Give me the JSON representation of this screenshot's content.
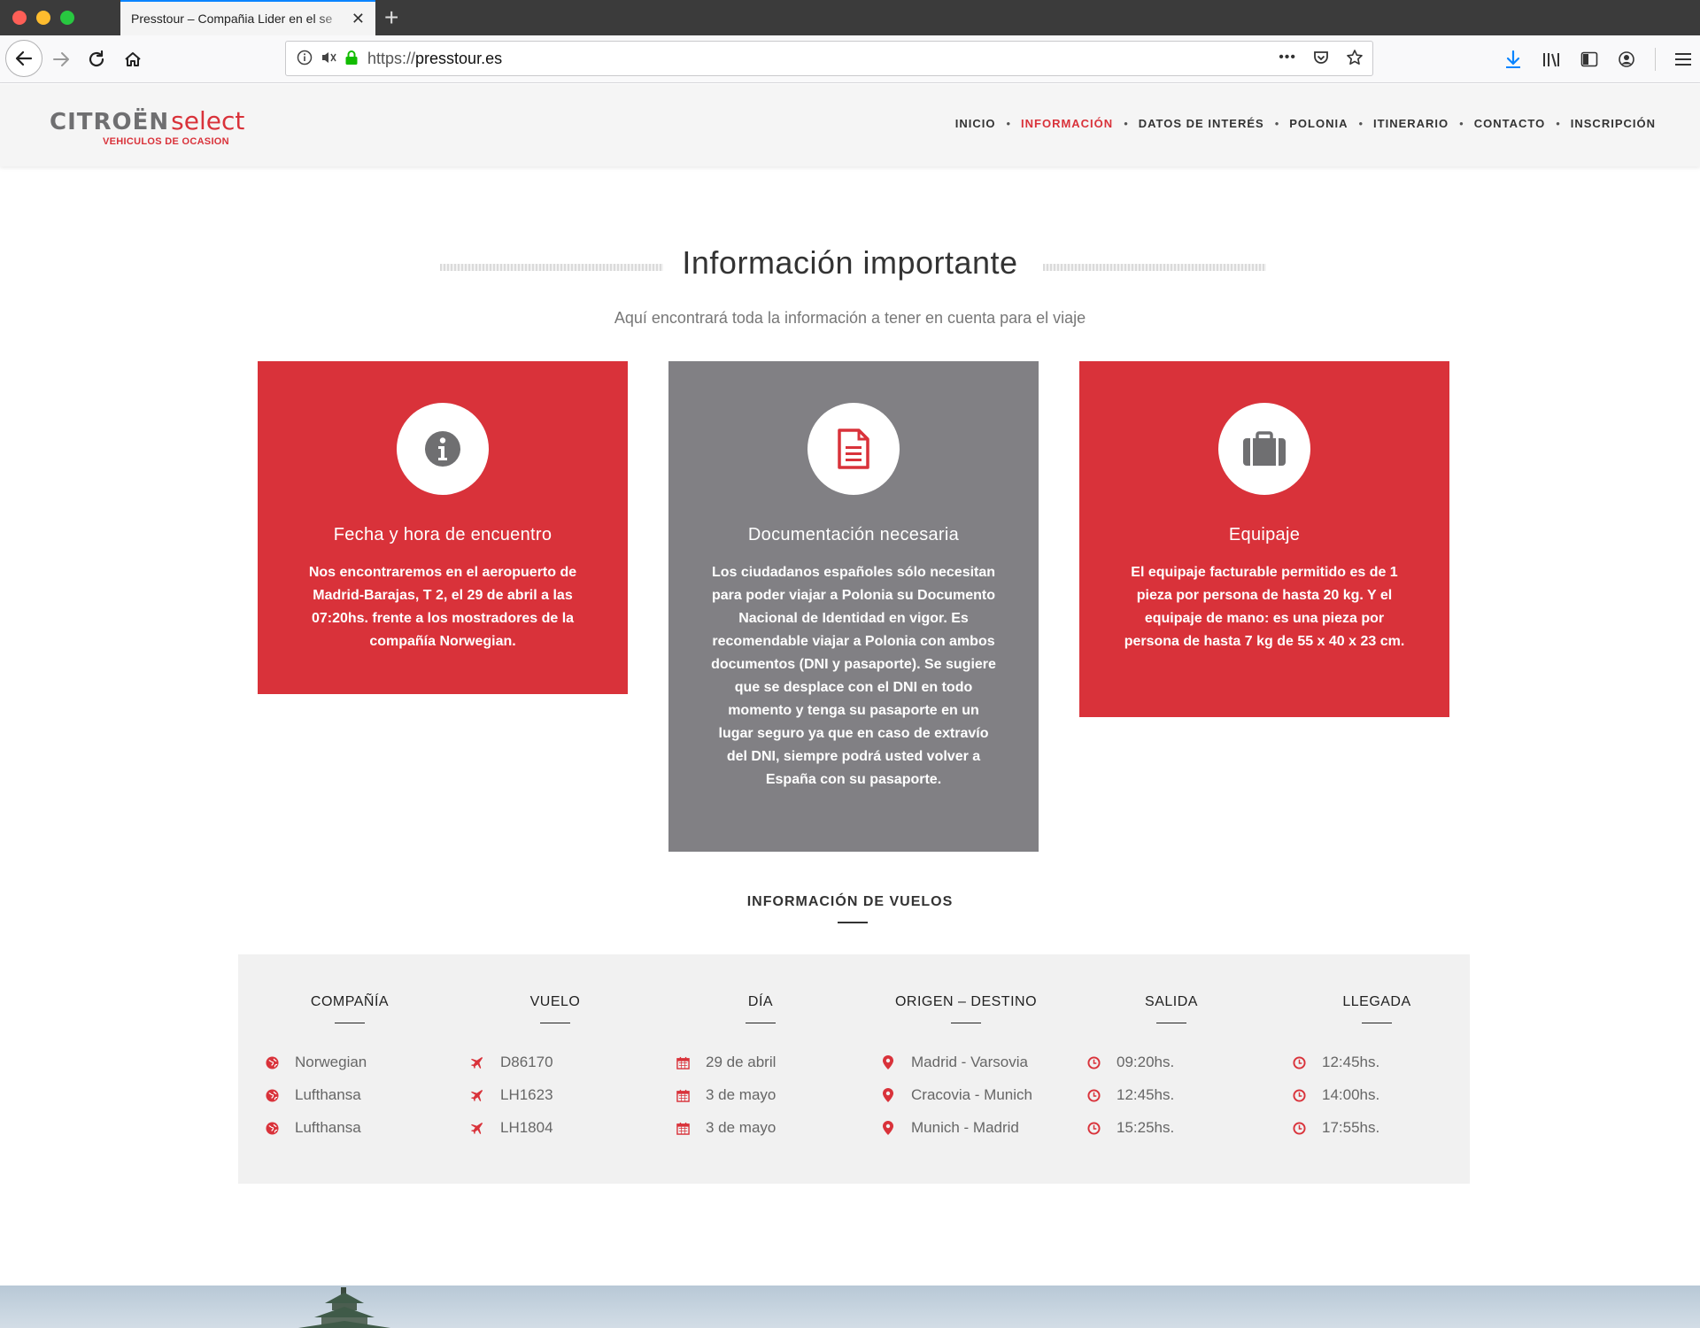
{
  "browser": {
    "tab_title": "Presstour – Compañia Lider en el se",
    "url_scheme": "https://",
    "url_host": "presstour.es",
    "overflow_label": "•••"
  },
  "site": {
    "logo_brand": "CITROËN",
    "logo_select": "select",
    "logo_sub": "VEHICULOS DE OCASION",
    "menu": [
      {
        "label": "INICIO",
        "active": false
      },
      {
        "label": "INFORMACIÓN",
        "active": true
      },
      {
        "label": "DATOS DE INTERÉS",
        "active": false
      },
      {
        "label": "POLONIA",
        "active": false
      },
      {
        "label": "ITINERARIO",
        "active": false
      },
      {
        "label": "CONTACTO",
        "active": false
      },
      {
        "label": "INSCRIPCIÓN",
        "active": false
      }
    ],
    "menu_separator": "•"
  },
  "info": {
    "title": "Información importante",
    "subtitle": "Aquí encontrará toda la información a tener en cuenta para el viaje",
    "cards": [
      {
        "icon": "info-icon",
        "title": "Fecha y hora de encuentro",
        "text": "Nos encontraremos en el aeropuerto de Madrid-Barajas, T 2, el 29 de abril a las 07:20hs. frente a los mostradores de la compañía Norwegian."
      },
      {
        "icon": "document-icon",
        "title": "Documentación necesaria",
        "text": "Los ciudadanos españoles sólo necesitan para poder viajar a Polonia su Documento Nacional de Identidad en vigor. Es recomendable viajar a Polonia con ambos documentos (DNI y pasaporte). Se sugiere que se desplace con el DNI en todo momento y tenga su pasaporte en un lugar seguro ya que en caso de extravío del DNI, siempre podrá usted volver a España con su pasaporte."
      },
      {
        "icon": "suitcase-icon",
        "title": "Equipaje",
        "text": "El equipaje facturable permitido es de 1 pieza por persona de hasta 20 kg. Y el equipaje de mano: es una pieza por persona de hasta 7 kg de 55 x 40 x 23 cm."
      }
    ]
  },
  "flights": {
    "heading": "INFORMACIÓN DE VUELOS",
    "columns": [
      {
        "header": "COMPAÑÍA",
        "icon": "globe-icon",
        "values": [
          "Norwegian",
          "Lufthansa",
          "Lufthansa"
        ]
      },
      {
        "header": "VUELO",
        "icon": "plane-icon",
        "values": [
          "D86170",
          "LH1623",
          "LH1804"
        ]
      },
      {
        "header": "DÍA",
        "icon": "calendar-icon",
        "values": [
          "29 de abril",
          "3 de mayo",
          "3 de mayo"
        ]
      },
      {
        "header": "ORIGEN – DESTINO",
        "icon": "map-pin-icon",
        "values": [
          "Madrid - Varsovia",
          "Cracovia - Munich",
          "Munich - Madrid"
        ]
      },
      {
        "header": "SALIDA",
        "icon": "clock-icon",
        "values": [
          "09:20hs.",
          "12:45hs.",
          "15:25hs."
        ]
      },
      {
        "header": "LLEGADA",
        "icon": "clock-icon",
        "values": [
          "12:45hs.",
          "14:00hs.",
          "17:55hs."
        ]
      }
    ]
  },
  "colors": {
    "accent": "#d9323a",
    "card_grey": "#818084",
    "panel_bg": "#f1f1f1"
  }
}
